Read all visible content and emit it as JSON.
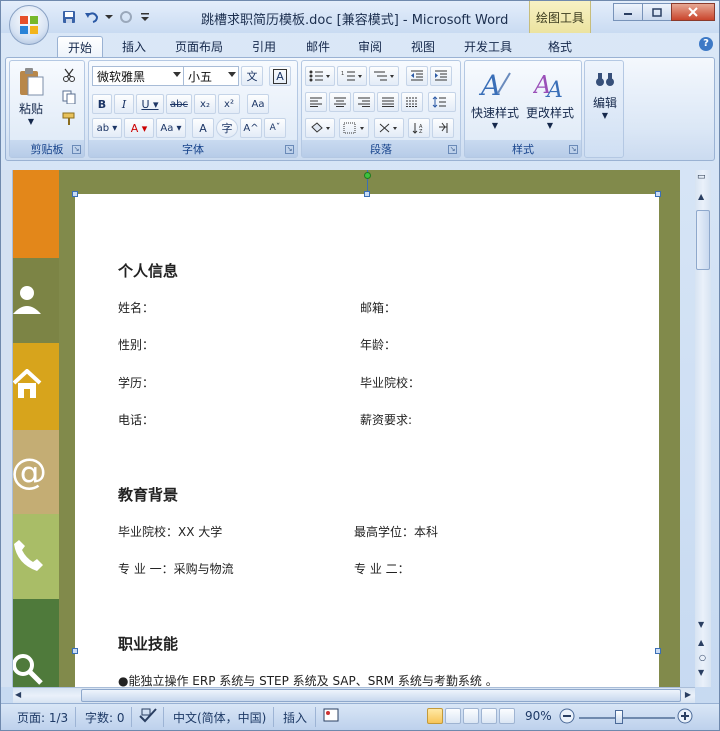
{
  "window": {
    "title": "跳槽求职简历模板.doc [兼容模式] - Microsoft Word",
    "context_tab": "绘图工具"
  },
  "tabs": [
    {
      "label": "开始",
      "active": true
    },
    {
      "label": "插入"
    },
    {
      "label": "页面布局"
    },
    {
      "label": "引用"
    },
    {
      "label": "邮件"
    },
    {
      "label": "审阅"
    },
    {
      "label": "视图"
    },
    {
      "label": "开发工具"
    },
    {
      "label": "格式"
    }
  ],
  "ribbon": {
    "clipboard": {
      "label": "剪贴板",
      "paste": "粘贴"
    },
    "font": {
      "label": "字体",
      "font_name": "微软雅黑",
      "font_size": "小五",
      "wen": "A"
    },
    "paragraph": {
      "label": "段落"
    },
    "styles": {
      "label": "样式",
      "quick": "快速样式",
      "change": "更改样式"
    },
    "editing": {
      "label": "编辑"
    }
  },
  "document": {
    "sections": [
      {
        "heading": "个人信息"
      },
      {
        "heading": "教育背景"
      },
      {
        "heading": "职业技能"
      }
    ],
    "personal": {
      "name": "姓名：",
      "email": "邮箱：",
      "gender": "性别：",
      "age": "年龄：",
      "edu": "学历：",
      "school": "毕业院校：",
      "phone": "电话：",
      "salary": "薪资要求:"
    },
    "education": {
      "school": "毕业院校：XX 大学",
      "degree": "最高学位：本科",
      "major1": "专  业  一：采购与物流",
      "major2": "专  业  二："
    },
    "skills": {
      "line1": "●能独立操作 ERP 系统与 STEP  系统及 SAP、SRM 系统与考勤系统 。"
    },
    "strip_colors": [
      "#e3871a",
      "#7c8445",
      "#d7a41c",
      "#c4ad74",
      "#a9bd67",
      "#4f7a3b"
    ]
  },
  "status": {
    "page": "页面: 1/3",
    "words": "字数: 0",
    "lang": "中文(简体，中国)",
    "mode": "插入",
    "zoom": "90%"
  }
}
